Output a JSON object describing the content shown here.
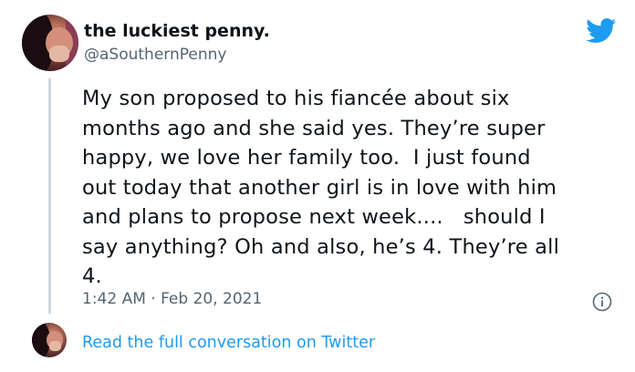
{
  "tweet": {
    "author_name": "the luckiest penny.",
    "author_handle": "@aSouthernPenny",
    "text": "My son proposed to his fiancée about six\nmonths ago and she said yes. They’re super\nhappy, we love her family too.  I just found\nout today that another girl is in love with him\nand plans to propose next week....   should I\nsay anything? Oh and also, he’s 4. They’re all\n4.",
    "timestamp": "1:42 AM · Feb 20, 2021"
  },
  "footer": {
    "read_more_label": "Read the full conversation on Twitter"
  },
  "icons": {
    "brand": "twitter-bird-icon",
    "info": "info-icon"
  },
  "colors": {
    "brand_blue": "#1d9bf0",
    "secondary_text": "#536471",
    "primary_text": "#0f1419",
    "thread_line": "#cfd9de"
  }
}
